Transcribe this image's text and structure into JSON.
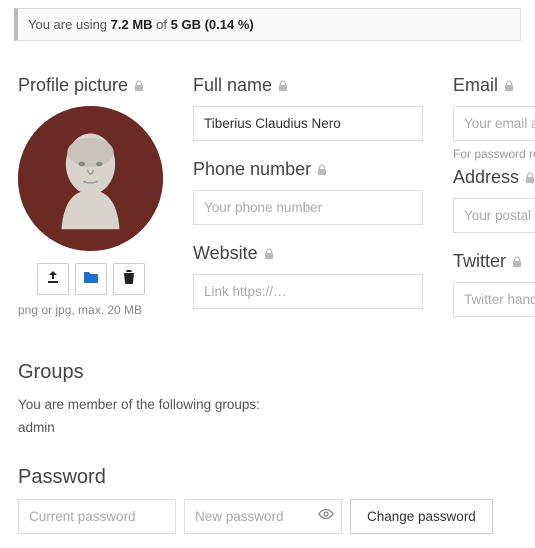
{
  "quota": {
    "prefix": "You are using ",
    "used": "7.2 MB",
    "of": " of ",
    "total": "5 GB",
    "pct": " (0.14 %)"
  },
  "profile_picture": {
    "label": "Profile picture",
    "hint": "png or jpg, max. 20 MB"
  },
  "full_name": {
    "label": "Full name",
    "value": "Tiberius Claudius Nero"
  },
  "phone": {
    "label": "Phone number",
    "placeholder": "Your phone number"
  },
  "website": {
    "label": "Website",
    "placeholder": "Link https://…"
  },
  "email": {
    "label": "Email",
    "placeholder": "Your email address",
    "help": "For password reset and notifications"
  },
  "address": {
    "label": "Address",
    "placeholder": "Your postal address"
  },
  "twitter": {
    "label": "Twitter",
    "placeholder": "Twitter handle @…"
  },
  "groups": {
    "title": "Groups",
    "intro": "You are member of the following groups:",
    "list": "admin"
  },
  "password": {
    "title": "Password",
    "current_placeholder": "Current password",
    "new_placeholder": "New password",
    "button": "Change password"
  }
}
